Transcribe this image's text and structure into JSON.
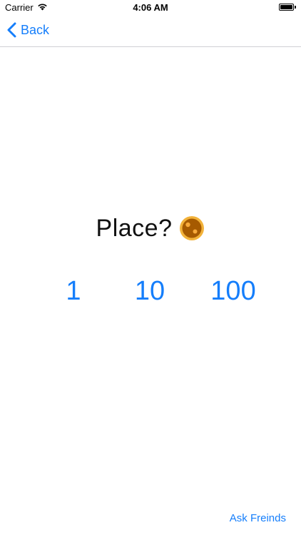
{
  "status_bar": {
    "carrier": "Carrier",
    "time": "4:06 AM"
  },
  "nav": {
    "back_label": "Back"
  },
  "main": {
    "question": "Place?",
    "options": [
      "1",
      "10",
      "100"
    ]
  },
  "footer": {
    "ask_friends_label": "Ask Freinds"
  },
  "colors": {
    "accent": "#157efb",
    "coin_outer": "#f2b23a",
    "coin_inner": "#a65a00"
  }
}
